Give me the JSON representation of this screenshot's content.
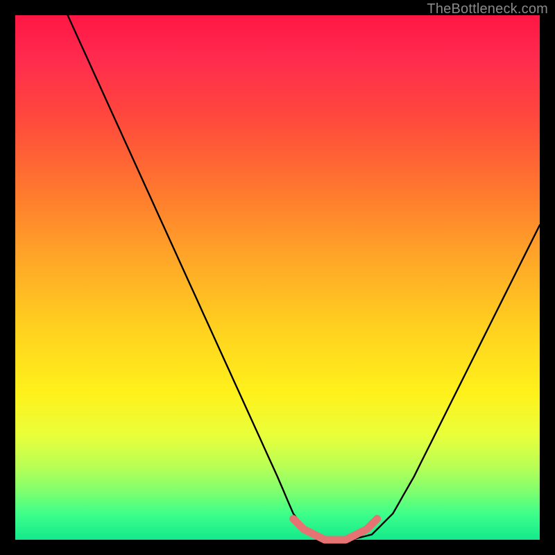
{
  "watermark": {
    "text": "TheBottleneck.com"
  },
  "chart_data": {
    "type": "line",
    "title": "",
    "xlabel": "",
    "ylabel": "",
    "xlim": [
      0,
      100
    ],
    "ylim": [
      0,
      100
    ],
    "annotations": [],
    "series": [
      {
        "name": "bottleneck-curve",
        "color": "#000000",
        "x": [
          10,
          15,
          20,
          25,
          30,
          35,
          40,
          45,
          50,
          53,
          56,
          60,
          64,
          68,
          72,
          76,
          80,
          85,
          90,
          95,
          100
        ],
        "y": [
          100,
          89,
          78,
          67,
          56,
          45,
          34,
          23,
          12,
          5,
          1,
          0,
          0,
          1,
          5,
          12,
          20,
          30,
          40,
          50,
          60
        ]
      },
      {
        "name": "optimal-range-marker",
        "color": "#e57373",
        "x": [
          53,
          55,
          57,
          59,
          61,
          63,
          65,
          67,
          69
        ],
        "y": [
          4,
          2,
          1,
          0,
          0,
          0,
          1,
          2,
          4
        ]
      }
    ],
    "background_gradient": {
      "orientation": "vertical",
      "stops": [
        {
          "pos": 0.0,
          "color": "#ff1744"
        },
        {
          "pos": 0.2,
          "color": "#ff4a3c"
        },
        {
          "pos": 0.46,
          "color": "#ffa528"
        },
        {
          "pos": 0.72,
          "color": "#fff11b"
        },
        {
          "pos": 0.91,
          "color": "#7cff6f"
        },
        {
          "pos": 1.0,
          "color": "#14e98c"
        }
      ]
    }
  }
}
